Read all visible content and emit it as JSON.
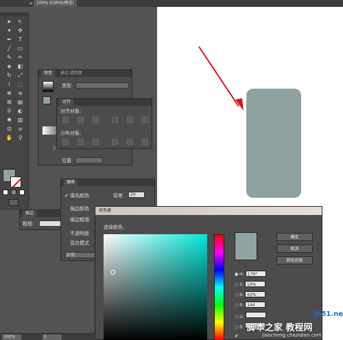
{
  "doc_tab": {
    "title": "100% (CMYK/预览)",
    "close": "×"
  },
  "toolbar": {
    "tools": [
      "select-arrow",
      "direct-select",
      "magic-wand",
      "lasso",
      "pen",
      "type",
      "line",
      "rect",
      "brush",
      "pencil",
      "blob-brush",
      "eraser",
      "rotate",
      "scale",
      "width",
      "warp",
      "free-transform",
      "shape-builder",
      "perspective",
      "mesh",
      "gradient",
      "eyedropper",
      "blend",
      "symbol-sprayer",
      "graph",
      "artboard",
      "slice",
      "hand",
      "zoom"
    ],
    "fill_color": "#91a3a2"
  },
  "gradient_panel": {
    "tab_active": "渐变",
    "tab_other": "描边 透明度",
    "type_label": "类型",
    "position_label": "位置"
  },
  "align_panel": {
    "title": "对齐",
    "align_objects": "对齐对象:",
    "distribute_objects": "分布对象:",
    "fragment": "不"
  },
  "stroke_panel": {
    "title": "描边",
    "weight_label": "粗细"
  },
  "magic_panel": {
    "title": "魔棒",
    "fill_color_label": "填充颜色",
    "tolerance_label": "容差",
    "tolerance_value": "20",
    "stroke_color_label": "描边颜色",
    "stroke_weight_label": "描边粗细",
    "opacity_label": "不透明度",
    "blend_label": "混合模式",
    "mode_value": "正常"
  },
  "color_dialog": {
    "title": "拾色器",
    "select_label": "选择颜色:",
    "ok": "确定",
    "cancel": "取消",
    "swatches": "颜色色板",
    "h_label": "H:",
    "h_value": "179°",
    "s_label": "S:",
    "s_value": "10%",
    "b_label": "B:",
    "b_value": "63%",
    "r_label": "R:",
    "r_value": "144",
    "g_label": "G:",
    "b2_label": "B:",
    "hex_prefix": "#"
  },
  "status": {
    "zoom": "100%",
    "page": "1"
  },
  "watermark": {
    "site": "jb51.net",
    "text": "脚本之家 教程网",
    "url": "jiaocheng.chazidian.com"
  },
  "colors": {
    "shape": "#8fa2a2",
    "arrow": "#d81414"
  }
}
